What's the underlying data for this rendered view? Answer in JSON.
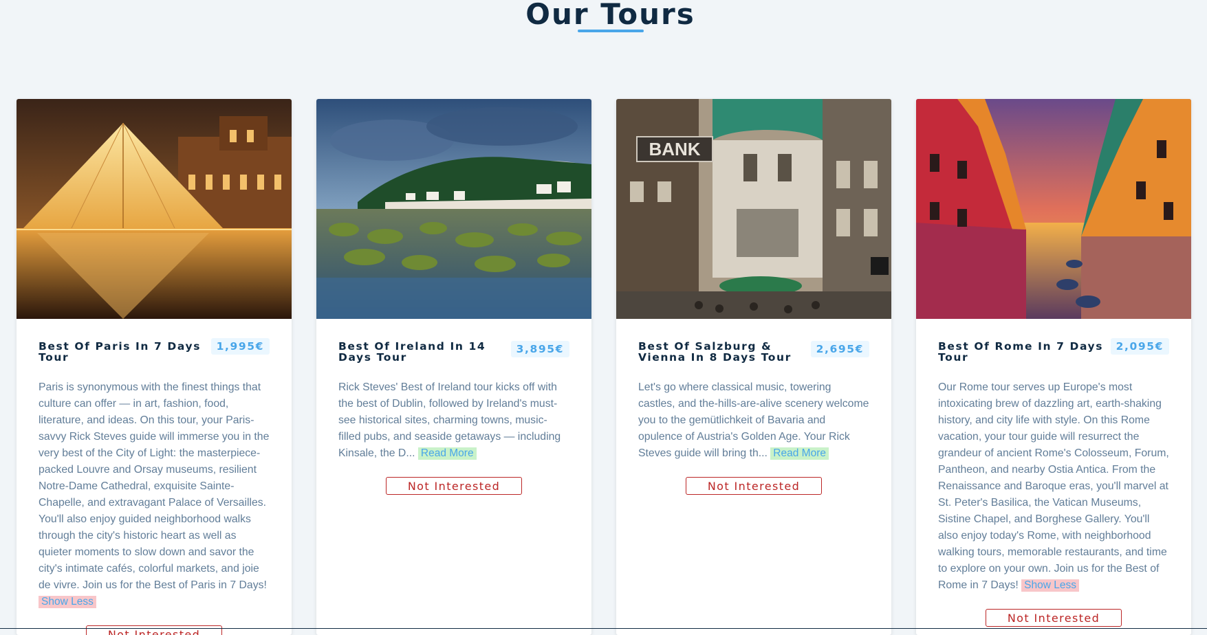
{
  "page": {
    "title": "Our Tours"
  },
  "tours": [
    {
      "name": "Best Of Paris In 7 Days Tour",
      "price": "1,995€",
      "image": "louvre-pyramid-at-night",
      "info": "Paris is synonymous with the finest things that culture can offer — in art, fashion, food, literature, and ideas. On this tour, your Paris-savvy Rick Steves guide will immerse you in the very best of the City of Light: the masterpiece-packed Louvre and Orsay museums, resilient Notre-Dame Cathedral, exquisite Sainte-Chapelle, and extravagant Palace of Versailles. You'll also enjoy guided neighborhood walks through the city's historic heart as well as quieter moments to slow down and savor the city's intimate cafés, colorful markets, and joie de vivre. Join us for the Best of Paris in 7 Days!",
      "toggle": "Show Less",
      "button": "Not Interested"
    },
    {
      "name": "Best Of Ireland In 14 Days Tour",
      "price": "3,895€",
      "image": "irish-coast-landscape",
      "info": "Rick Steves' Best of Ireland tour kicks off with the best of Dublin, followed by Ireland's must-see historical sites, charming towns, music-filled pubs, and seaside getaways — including Kinsale, the D...",
      "toggle": "Read More",
      "button": "Not Interested"
    },
    {
      "name": "Best Of Salzburg & Vienna In 8 Days Tour",
      "price": "2,695€",
      "image": "vienna-street-with-bank-sign",
      "image_sign": "BANK",
      "info": "Let's go where classical music, towering castles, and the-hills-are-alive scenery welcome you to the gemütlichkeit of Bavaria and opulence of Austria's Golden Age. Your Rick Steves guide will bring th...",
      "toggle": "Read More",
      "button": "Not Interested"
    },
    {
      "name": "Best Of Rome In 7 Days Tour",
      "price": "2,095€",
      "image": "colorful-canal-at-sunset",
      "info": "Our Rome tour serves up Europe's most intoxicating brew of dazzling art, earth-shaking history, and city life with style. On this Rome vacation, your tour guide will resurrect the grandeur of ancient Rome's Colosseum, Forum, Pantheon, and nearby Ostia Antica. From the Renaissance and Baroque eras, you'll marvel at St. Peter's Basilica, the Vatican Museums, Sistine Chapel, and Borghese Gallery. You'll also enjoy today's Rome, with neighborhood walking tours, memorable restaurants, and time to explore on your own. Join us for the Best of Rome in 7 Days!",
      "toggle": "Show Less",
      "button": "Not Interested"
    }
  ]
}
